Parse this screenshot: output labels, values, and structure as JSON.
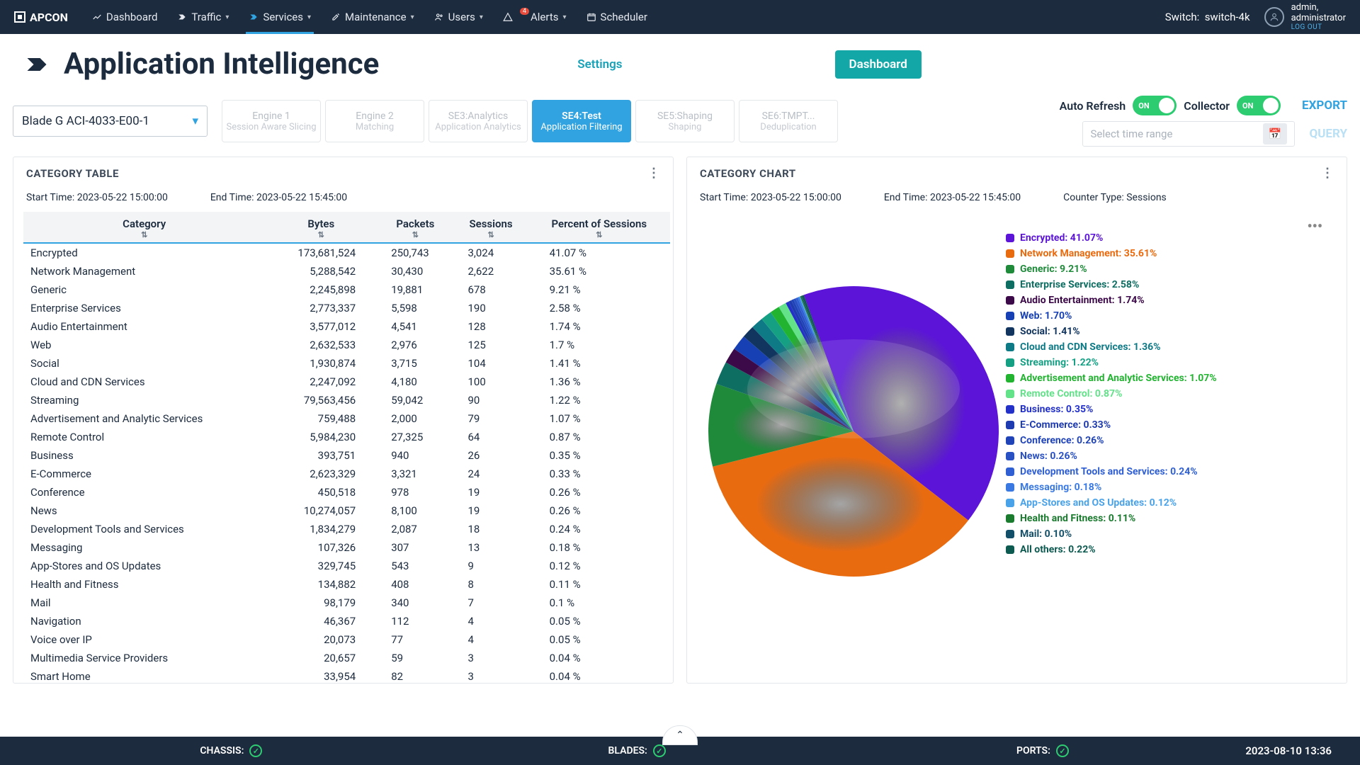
{
  "brand": "APCON",
  "nav": [
    {
      "label": "Dashboard",
      "icon": "dashboard",
      "chev": false
    },
    {
      "label": "Traffic",
      "icon": "traffic",
      "chev": true
    },
    {
      "label": "Services",
      "icon": "services",
      "chev": true,
      "active": true
    },
    {
      "label": "Maintenance",
      "icon": "maintenance",
      "chev": true
    },
    {
      "label": "Users",
      "icon": "users",
      "chev": true
    },
    {
      "label": "Alerts",
      "icon": "alerts",
      "chev": true,
      "badge": "4"
    },
    {
      "label": "Scheduler",
      "icon": "scheduler",
      "chev": false
    }
  ],
  "switch": {
    "label": "Switch:",
    "value": "switch-4k"
  },
  "user": {
    "name": "admin,",
    "role": "administrator",
    "logout": "LOG OUT"
  },
  "page": {
    "title": "Application Intelligence",
    "settings": "Settings",
    "dashboard": "Dashboard"
  },
  "blade": "Blade G ACI-4033-E00-1",
  "engines": [
    {
      "t": "Engine 1",
      "s": "Session Aware Slicing"
    },
    {
      "t": "Engine 2",
      "s": "Matching"
    },
    {
      "t": "SE3:Analytics",
      "s": "Application Analytics"
    },
    {
      "t": "SE4:Test",
      "s": "Application Filtering",
      "active": true
    },
    {
      "t": "SE5:Shaping",
      "s": "Shaping"
    },
    {
      "t": "SE6:TMPT...",
      "s": "Deduplication"
    }
  ],
  "toggles": {
    "autorefresh": {
      "label": "Auto Refresh",
      "state": "ON"
    },
    "collector": {
      "label": "Collector",
      "state": "ON"
    }
  },
  "export": "EXPORT",
  "query": "QUERY",
  "time_placeholder": "Select time range",
  "table_panel": {
    "title": "CATEGORY TABLE",
    "start": "Start Time: 2023-05-22 15:00:00",
    "end": "End Time: 2023-05-22 15:45:00",
    "columns": [
      "Category",
      "Bytes",
      "Packets",
      "Sessions",
      "Percent of Sessions"
    ]
  },
  "chart_panel": {
    "title": "CATEGORY CHART",
    "start": "Start Time: 2023-05-22 15:00:00",
    "end": "End Time: 2023-05-22 15:45:00",
    "counter": "Counter Type: Sessions"
  },
  "rows": [
    {
      "cat": "Encrypted",
      "bytes": "173,681,524",
      "packets": "250,743",
      "sessions": "3,024",
      "pct": "41.07 %"
    },
    {
      "cat": "Network Management",
      "bytes": "5,288,542",
      "packets": "30,430",
      "sessions": "2,622",
      "pct": "35.61 %"
    },
    {
      "cat": "Generic",
      "bytes": "2,245,898",
      "packets": "19,881",
      "sessions": "678",
      "pct": "9.21 %"
    },
    {
      "cat": "Enterprise Services",
      "bytes": "2,773,337",
      "packets": "5,598",
      "sessions": "190",
      "pct": "2.58 %"
    },
    {
      "cat": "Audio Entertainment",
      "bytes": "3,577,012",
      "packets": "4,541",
      "sessions": "128",
      "pct": "1.74 %"
    },
    {
      "cat": "Web",
      "bytes": "2,632,533",
      "packets": "2,976",
      "sessions": "125",
      "pct": "1.7 %"
    },
    {
      "cat": "Social",
      "bytes": "1,930,874",
      "packets": "3,715",
      "sessions": "104",
      "pct": "1.41 %"
    },
    {
      "cat": "Cloud and CDN Services",
      "bytes": "2,247,092",
      "packets": "4,180",
      "sessions": "100",
      "pct": "1.36 %"
    },
    {
      "cat": "Streaming",
      "bytes": "79,563,456",
      "packets": "59,042",
      "sessions": "90",
      "pct": "1.22 %"
    },
    {
      "cat": "Advertisement and Analytic Services",
      "bytes": "759,488",
      "packets": "2,000",
      "sessions": "79",
      "pct": "1.07 %"
    },
    {
      "cat": "Remote Control",
      "bytes": "5,984,230",
      "packets": "27,325",
      "sessions": "64",
      "pct": "0.87 %"
    },
    {
      "cat": "Business",
      "bytes": "393,751",
      "packets": "940",
      "sessions": "26",
      "pct": "0.35 %"
    },
    {
      "cat": "E-Commerce",
      "bytes": "2,623,329",
      "packets": "3,321",
      "sessions": "24",
      "pct": "0.33 %"
    },
    {
      "cat": "Conference",
      "bytes": "450,518",
      "packets": "978",
      "sessions": "19",
      "pct": "0.26 %"
    },
    {
      "cat": "News",
      "bytes": "10,274,057",
      "packets": "8,100",
      "sessions": "19",
      "pct": "0.26 %"
    },
    {
      "cat": "Development Tools and Services",
      "bytes": "1,834,279",
      "packets": "2,087",
      "sessions": "18",
      "pct": "0.24 %"
    },
    {
      "cat": "Messaging",
      "bytes": "107,326",
      "packets": "307",
      "sessions": "13",
      "pct": "0.18 %"
    },
    {
      "cat": "App-Stores and OS Updates",
      "bytes": "329,745",
      "packets": "543",
      "sessions": "9",
      "pct": "0.12 %"
    },
    {
      "cat": "Health and Fitness",
      "bytes": "134,882",
      "packets": "408",
      "sessions": "8",
      "pct": "0.11 %"
    },
    {
      "cat": "Mail",
      "bytes": "98,179",
      "packets": "340",
      "sessions": "7",
      "pct": "0.1 %"
    },
    {
      "cat": "Navigation",
      "bytes": "46,367",
      "packets": "112",
      "sessions": "4",
      "pct": "0.05 %"
    },
    {
      "cat": "Voice over IP",
      "bytes": "20,073",
      "packets": "77",
      "sessions": "4",
      "pct": "0.05 %"
    },
    {
      "cat": "Multimedia Service Providers",
      "bytes": "20,657",
      "packets": "59",
      "sessions": "3",
      "pct": "0.04 %"
    },
    {
      "cat": "Smart Home",
      "bytes": "33,954",
      "packets": "82",
      "sessions": "3",
      "pct": "0.04 %"
    }
  ],
  "chart_data": {
    "type": "pie",
    "title": "Category Chart — Sessions",
    "series": [
      {
        "name": "Encrypted",
        "value": 41.07,
        "color": "#5b14d8"
      },
      {
        "name": "Network Management",
        "value": 35.61,
        "color": "#e96b10"
      },
      {
        "name": "Generic",
        "value": 9.21,
        "color": "#1f8b3a"
      },
      {
        "name": "Enterprise Services",
        "value": 2.58,
        "color": "#0e6e62"
      },
      {
        "name": "Audio Entertainment",
        "value": 1.74,
        "color": "#3d0a49"
      },
      {
        "name": "Web",
        "value": 1.7,
        "color": "#1740b5"
      },
      {
        "name": "Social",
        "value": 1.41,
        "color": "#12355f"
      },
      {
        "name": "Cloud and CDN Services",
        "value": 1.36,
        "color": "#0e7a86"
      },
      {
        "name": "Streaming",
        "value": 1.22,
        "color": "#15a084"
      },
      {
        "name": "Advertisement and Analytic Services",
        "value": 1.07,
        "color": "#22b431"
      },
      {
        "name": "Remote Control",
        "value": 0.87,
        "color": "#63e28a"
      },
      {
        "name": "Business",
        "value": 0.35,
        "color": "#2331c9"
      },
      {
        "name": "E-Commerce",
        "value": 0.33,
        "color": "#1f3bb0"
      },
      {
        "name": "Conference",
        "value": 0.26,
        "color": "#2044b8"
      },
      {
        "name": "News",
        "value": 0.26,
        "color": "#2a51c4"
      },
      {
        "name": "Development Tools and Services",
        "value": 0.24,
        "color": "#2f5fd2"
      },
      {
        "name": "Messaging",
        "value": 0.18,
        "color": "#3a79e2"
      },
      {
        "name": "App-Stores and OS Updates",
        "value": 0.12,
        "color": "#4aa3e8"
      },
      {
        "name": "Health and Fitness",
        "value": 0.11,
        "color": "#1a7a2e"
      },
      {
        "name": "Mail",
        "value": 0.1,
        "color": "#134f68"
      },
      {
        "name": "All others",
        "value": 0.22,
        "color": "#0d5a50"
      }
    ]
  },
  "footer": {
    "chassis": "CHASSIS:",
    "blades": "BLADES:",
    "ports": "PORTS:",
    "time": "2023-08-10  13:36"
  }
}
